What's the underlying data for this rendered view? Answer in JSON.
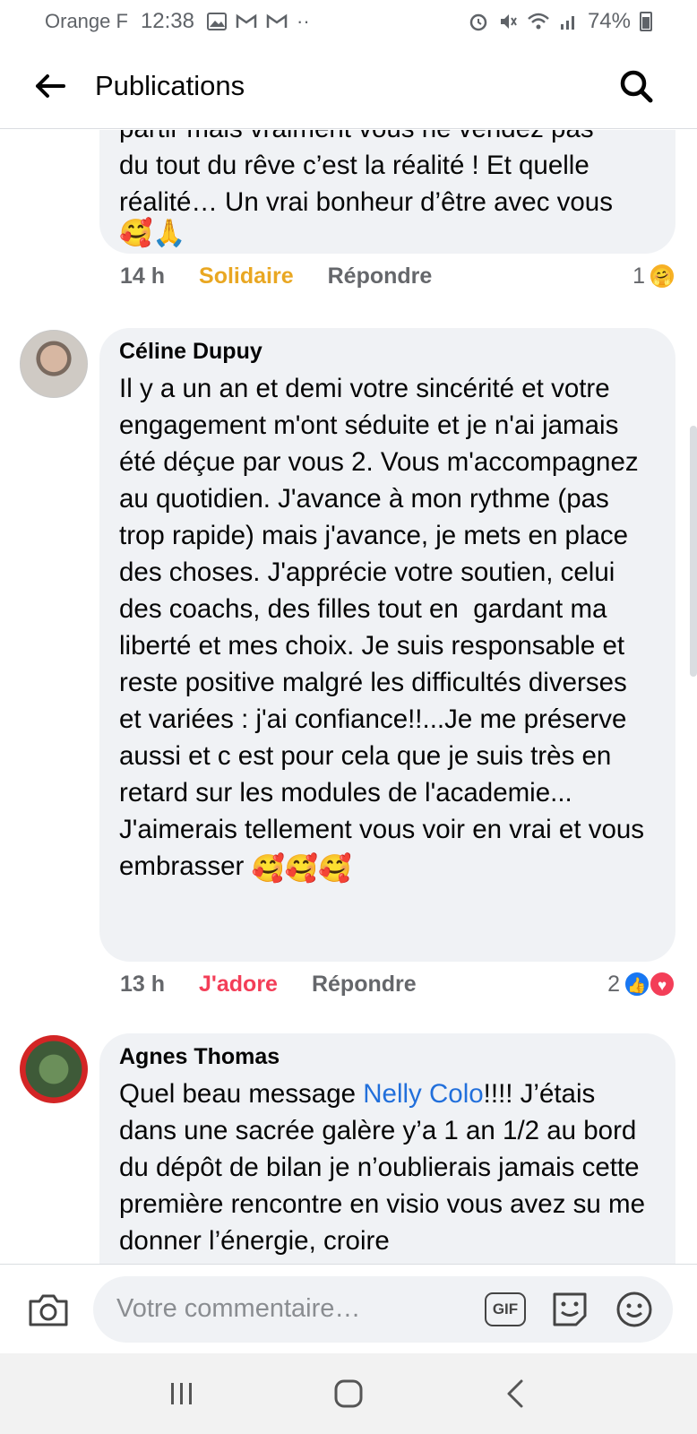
{
  "status_bar": {
    "carrier": "Orange F",
    "time": "12:38",
    "battery": "74%"
  },
  "header": {
    "title": "Publications"
  },
  "comments": [
    {
      "text": "du tout du rêve c’est la réalité ! Et quelle réalité… Un vrai bonheur d’être avec vous",
      "partial_text": "partir mais vraiment vous ne vendez pas",
      "emojis": "🥰🙏",
      "time": "14 h",
      "reaction_label": "Solidaire",
      "reaction_color": "#e9a722",
      "reply_label": "Répondre",
      "reaction_count": "1"
    },
    {
      "author": "Céline Dupuy",
      "text": "Il y a un an et demi votre sincérité et votre engagement m'ont séduite et je n'ai jamais été déçue par vous 2. Vous m'accompagnez au quotidien. J'avance à mon rythme (pas trop rapide) mais j'avance, je mets en place des choses. J'apprécie votre soutien, celui des coachs, des filles tout en  gardant ma liberté et mes choix. Je suis responsable et reste positive malgré les difficultés diverses et variées : j'ai confiance!!...Je me préserve aussi et c est pour cela que je suis très en retard sur les modules de l'academie...",
      "text2": "J'aimerais tellement vous voir en vrai et vous embrasser",
      "emojis": "🥰🥰🥰",
      "time": "13 h",
      "reaction_label": "J'adore",
      "reaction_color": "#f33e58",
      "reply_label": "Répondre",
      "reaction_count": "2"
    },
    {
      "author": "Agnes Thomas",
      "text_before": "Quel beau message ",
      "mention": "Nelly Colo",
      "text_after": "!!!! J’étais dans une sacrée galère y’a 1 an 1/2 au bord du dépôt de bilan je n’oublierais jamais cette première rencontre en visio vous avez su me donner l’énergie, croire"
    }
  ],
  "composer": {
    "placeholder": "Votre commentaire…",
    "gif_label": "GIF"
  },
  "icons": {
    "back": "arrow-left-icon",
    "search": "search-icon",
    "camera": "camera-icon",
    "gif": "gif-icon",
    "sticker": "sticker-icon",
    "emoji": "emoji-icon",
    "nav_recents": "recents-icon",
    "nav_home": "home-icon",
    "nav_back": "nav-back-icon"
  }
}
